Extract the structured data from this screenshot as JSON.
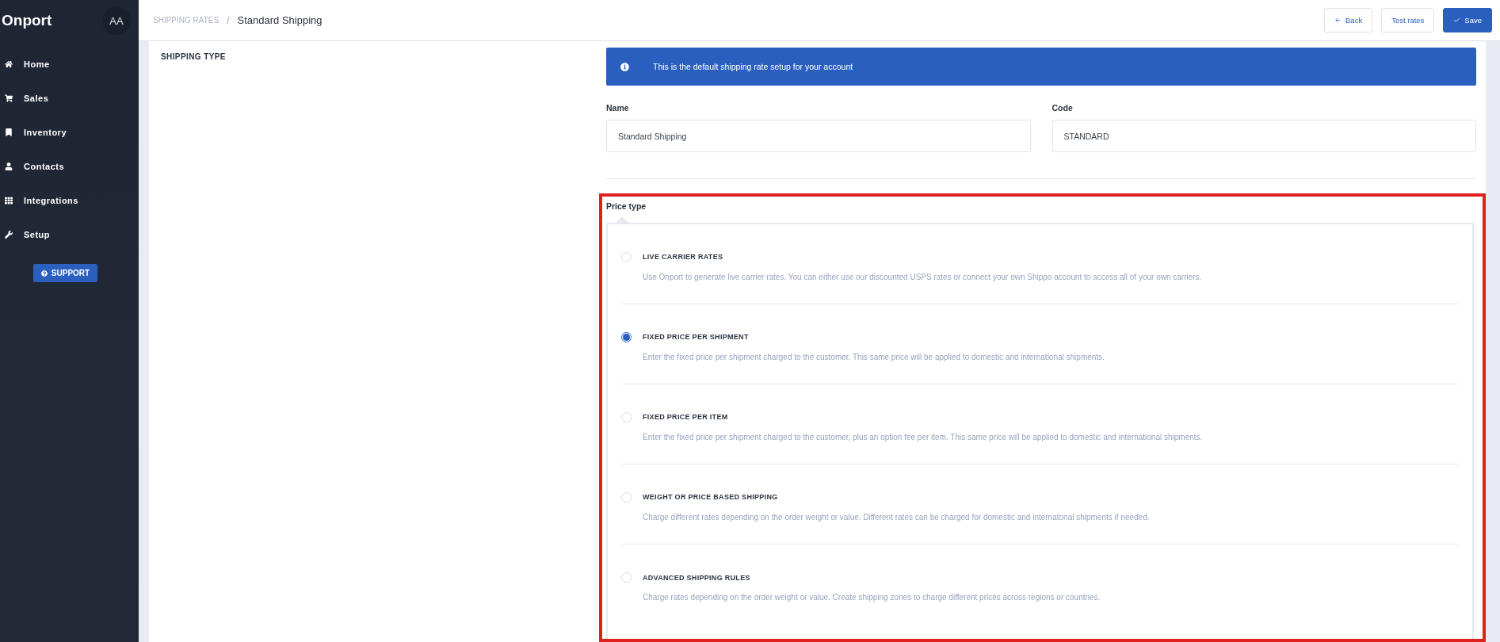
{
  "sidebar": {
    "logo": "Onport",
    "avatar": "AA",
    "items": [
      {
        "label": "Home"
      },
      {
        "label": "Sales"
      },
      {
        "label": "Inventory"
      },
      {
        "label": "Contacts"
      },
      {
        "label": "Integrations"
      },
      {
        "label": "Setup"
      }
    ],
    "support_button": "SUPPORT"
  },
  "header": {
    "breadcrumb": [
      "SHIPPING RATES",
      "Standard Shipping"
    ],
    "separator": "/",
    "buttons": [
      {
        "label": "Back",
        "kind": "back"
      },
      {
        "label": "Test rates",
        "kind": "plain"
      },
      {
        "label": "Save",
        "kind": "primary"
      }
    ]
  },
  "section_title": "SHIPPING TYPE",
  "banner": "This is the default shipping rate setup for your account",
  "fields": [
    {
      "label": "Name",
      "value": "Standard Shipping"
    },
    {
      "label": "Code",
      "value": "STANDARD"
    }
  ],
  "price_type": {
    "label": "Price type",
    "options": [
      {
        "title": "LIVE CARRIER RATES",
        "description": "Use Onport to generate live carrier rates. You can either use our discounted USPS rates or connect your own Shippo account to access all of your own carriers.",
        "selected": false
      },
      {
        "title": "FIXED PRICE PER SHIPMENT",
        "description": "Enter the fixed price per shipment charged to the customer. This same price will be applied to domestic and international shipments.",
        "selected": true
      },
      {
        "title": "FIXED PRICE PER ITEM",
        "description": "Enter the fixed price per shipment charged to the customer, plus an option fee per item. This same price will be applied to domestic and international shipments.",
        "selected": false
      },
      {
        "title": "WEIGHT OR PRICE BASED SHIPPING",
        "description": "Charge different rates depending on the order weight or value. Different rates can be charged for domestic and internatonal shipments if needed.",
        "selected": false
      },
      {
        "title": "ADVANCED SHIPPING RULES",
        "description": "Charge rates depending on the order weight or value. Create shipping zones to charge different prices across regions or countries.",
        "selected": false
      }
    ]
  }
}
